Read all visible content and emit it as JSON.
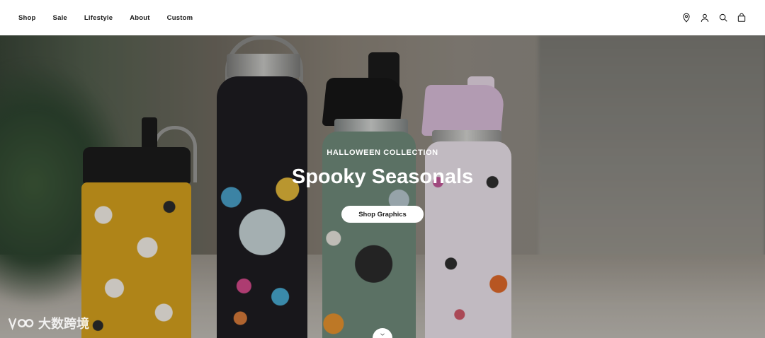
{
  "nav": {
    "items": [
      {
        "label": "Shop"
      },
      {
        "label": "Sale"
      },
      {
        "label": "Lifestyle"
      },
      {
        "label": "About"
      },
      {
        "label": "Custom"
      }
    ]
  },
  "header_icons": [
    "location-pin-icon",
    "account-icon",
    "search-icon",
    "cart-bag-icon"
  ],
  "hero": {
    "eyebrow": "HALLOWEEN COLLECTION",
    "title": "Spooky Seasonals",
    "cta_label": "Shop Graphics"
  },
  "watermark": {
    "text": "大数跨境"
  }
}
